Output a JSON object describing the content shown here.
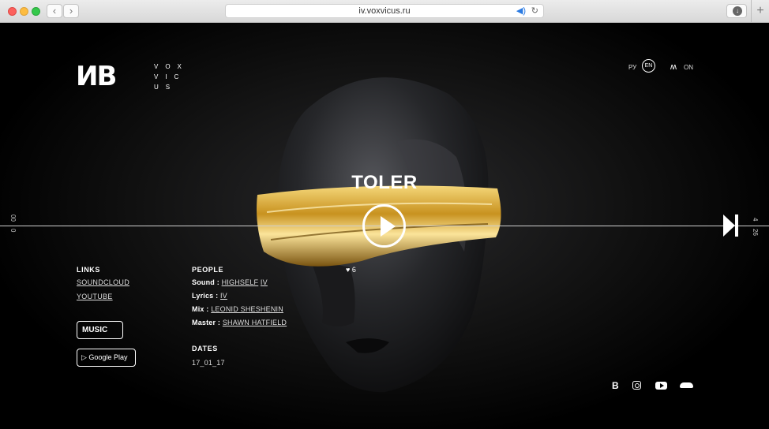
{
  "browser": {
    "url": "iv.voxvicus.ru",
    "back_icon": "‹",
    "forward_icon": "›",
    "plus": "+"
  },
  "header": {
    "logo": "ИВ",
    "brand_line1": "VOX",
    "brand_line2": "VIC",
    "brand_line3": "US",
    "lang_ru": "РУ",
    "lang_en": "EN",
    "sound_label": "ON"
  },
  "player": {
    "title": "TOLER",
    "time_left_top": "00",
    "time_left_bottom": "0",
    "time_right_top": "4",
    "time_right_bottom": "26",
    "likes": "6"
  },
  "links": {
    "heading": "LINKS",
    "items": [
      "SOUNDCLOUD",
      "YOUTUBE"
    ]
  },
  "stores": {
    "apple": "MUSIC",
    "google": "Google Play"
  },
  "people": {
    "heading": "PEOPLE",
    "sound_label": "Sound :",
    "sound_a": "HIGHSELF",
    "sound_b": "IV",
    "lyrics_label": "Lyrics :",
    "lyrics_a": "IV",
    "mix_label": "Mix :",
    "mix_a": "LEONID SHESHENIN",
    "master_label": "Master :",
    "master_a": "SHAWN HATFIELD"
  },
  "dates": {
    "heading": "DATES",
    "value": "17_01_17"
  },
  "social": {
    "b": "B"
  },
  "colors": {
    "gold": "#d4a437",
    "background": "#000000"
  }
}
